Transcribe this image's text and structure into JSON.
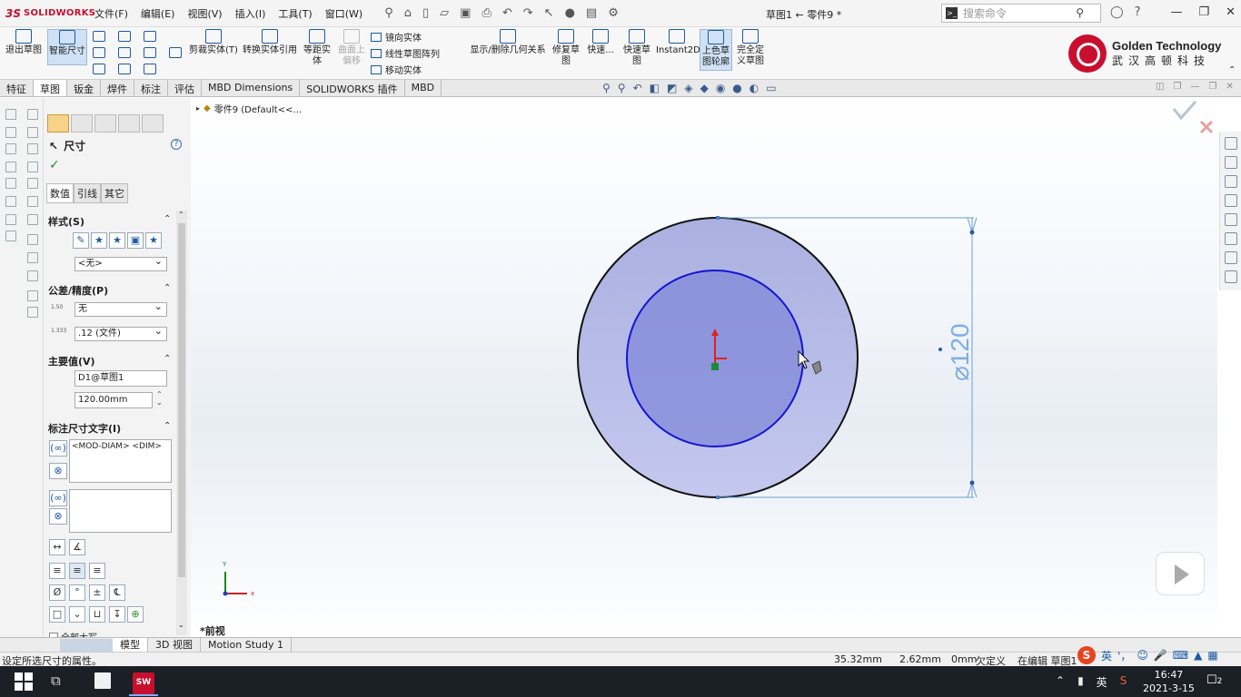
{
  "app": {
    "logo_ds": "3S",
    "logo_text": "SOLIDWORKS",
    "doc_title": "草图1 ← 零件9 *",
    "search_placeholder": "搜索命令"
  },
  "menu": [
    "文件(F)",
    "编辑(E)",
    "视图(V)",
    "插入(I)",
    "工具(T)",
    "窗口(W)"
  ],
  "commands": {
    "exit_sketch": "退出草图",
    "smart_dim": "智能尺寸",
    "trim_entities": "剪裁实体(T)",
    "convert_entities": "转换实体引用",
    "offset_entities": [
      "等距实",
      "体"
    ],
    "surface_offset": [
      "曲面上",
      "偏移"
    ],
    "mirror_entities": "镜向实体",
    "linear_pattern": "线性草图阵列",
    "move_entities": "移动实体",
    "display_relations": "显示/删除几何关系",
    "repair_sketch": [
      "修复草",
      "图"
    ],
    "quick_snaps": [
      "快速..."
    ],
    "rapid_sketch": [
      "快速草",
      "图"
    ],
    "instant2d": "Instant2D",
    "shaded_contours": [
      "上色草",
      "图轮廓"
    ],
    "fully_define": [
      "完全定",
      "义草图"
    ]
  },
  "company": {
    "name_en": "Golden Technology",
    "name_cn": "武汉高顿科技"
  },
  "tabs": [
    "特征",
    "草图",
    "钣金",
    "焊件",
    "标注",
    "评估",
    "MBD Dimensions",
    "SOLIDWORKS 插件",
    "MBD"
  ],
  "active_tab": "草图",
  "property_manager": {
    "title": "尺寸",
    "help": "?",
    "ok": "✓",
    "subtabs": [
      "数值",
      "引线",
      "其它"
    ],
    "style": {
      "header": "样式(S)",
      "dropdown": "<无>"
    },
    "tolerance": {
      "header": "公差/精度(P)",
      "tolerance_type": "无",
      "precision": ".12 (文件)",
      "tol_icon_top": "1.50",
      "tol_icon_sub_plus": "+.01",
      "tol_icon_sub_minus": "-.01",
      "prec_icon_top": ".01",
      "prec_icon_mid": "1.333",
      "prec_icon_bot": ".01"
    },
    "primary_value": {
      "header": "主要值(V)",
      "name": "D1@草图1",
      "value": "120.00mm"
    },
    "dimension_text": {
      "header": "标注尺寸文字(I)",
      "text": "<MOD-DIAM> <DIM>"
    },
    "symbols": [
      "Ø",
      "°",
      "±",
      "℄"
    ],
    "bottom_cut": "全部大写"
  },
  "graphics": {
    "tree_node": "零件9  (Default<<...",
    "view_name": "*前视",
    "dimension_text": "⌀120",
    "axis_x": "x",
    "axis_y": "Y"
  },
  "model_tabs": [
    "模型",
    "3D 视图",
    "Motion Study 1"
  ],
  "status": {
    "hint": "设定所选尺寸的属性。",
    "x": "35.32mm",
    "y": "2.62mm",
    "z": "0mm",
    "define": "欠定义",
    "editing": "在编辑 草图1"
  },
  "ime": {
    "logo": "S",
    "lang": "英",
    "punct": "'，"
  },
  "taskbar": {
    "app_label": "SW",
    "app_year": "2021",
    "lang": "英",
    "time": "16:47",
    "date": "2021-3-15",
    "notifications": "2"
  }
}
